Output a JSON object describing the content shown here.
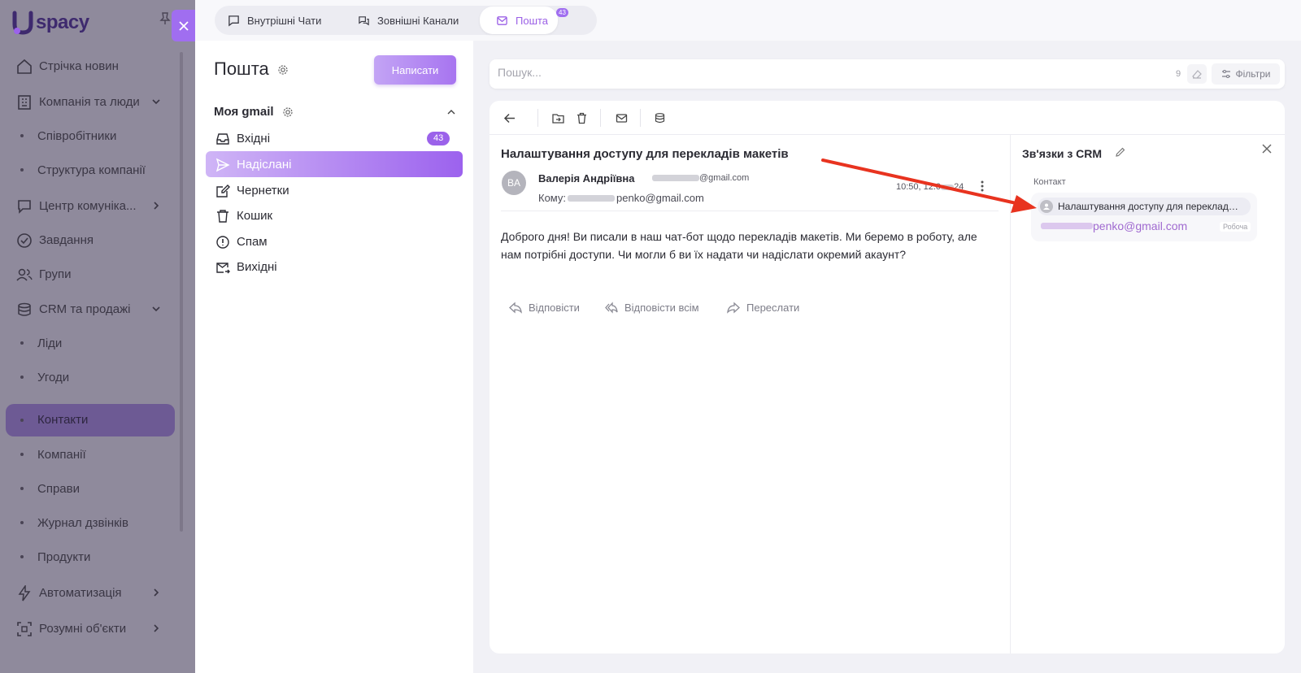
{
  "brand": {
    "logo_text": "spacy",
    "accent": "#a06ef0"
  },
  "sidebar": {
    "items": [
      {
        "label": "Стрічка новин",
        "icon": "home-icon"
      },
      {
        "label": "Компанія та люди",
        "icon": "building-icon"
      },
      {
        "label": "Співробітники"
      },
      {
        "label": "Структура компанії"
      },
      {
        "label": "Центр комуніка...",
        "icon": "chat-icon"
      },
      {
        "label": "Завдання",
        "icon": "check-circle-icon"
      },
      {
        "label": "Групи",
        "icon": "users-icon"
      },
      {
        "label": "CRM та продажі",
        "icon": "coins-icon"
      },
      {
        "label": "Ліди"
      },
      {
        "label": "Угоди"
      },
      {
        "label": "Контакти"
      },
      {
        "label": "Компанії"
      },
      {
        "label": "Справи"
      },
      {
        "label": "Журнал дзвінків"
      },
      {
        "label": "Продукти"
      },
      {
        "label": "Автоматизація",
        "icon": "bolt-icon"
      },
      {
        "label": "Розумні об'єкти",
        "icon": "scan-icon"
      }
    ]
  },
  "tabs": [
    {
      "label": "Внутрішні Чати",
      "icon": "chat-bubble-icon"
    },
    {
      "label": "Зовнішні Канали",
      "icon": "channels-icon"
    },
    {
      "label": "Пошта",
      "icon": "mail-icon",
      "badge": "43"
    }
  ],
  "folders": {
    "title": "Пошта",
    "compose_label": "Написати",
    "account": "Моя gmail",
    "items": [
      {
        "label": "Вхідні",
        "icon": "inbox-icon",
        "count": "43"
      },
      {
        "label": "Надіслані",
        "icon": "send-icon"
      },
      {
        "label": "Чернетки",
        "icon": "edit-icon"
      },
      {
        "label": "Кошик",
        "icon": "trash-icon"
      },
      {
        "label": "Спам",
        "icon": "alert-circle-icon"
      },
      {
        "label": "Вихідні",
        "icon": "outbox-icon"
      }
    ]
  },
  "search": {
    "placeholder": "Пошук...",
    "count": "9",
    "filters_label": "Фільтри"
  },
  "mail": {
    "subject": "Налаштування доступу для перекладів макетів",
    "avatar_initials": "BA",
    "sender_name": "Валерія Андріївна",
    "sender_email_suffix": "@gmail.com",
    "to_label": "Кому:",
    "to_email_suffix": "penko@gmail.com",
    "time": "10:50, 12.0",
    "time_tail": "24",
    "body": "Доброго дня! Ви писали в наш чат-бот щодо перекладів макетів. Ми беремо в роботу, але нам потрібні доступи. Чи могли б ви їх надати чи надіслати окремий акаунт?",
    "reply_label": "Відповісти",
    "reply_all_label": "Відповісти всім",
    "forward_label": "Переслати"
  },
  "crm": {
    "title": "Зв'язки з CRM",
    "section_label": "Контакт",
    "contact_name": "Налаштування доступу для перекладів макетів",
    "contact_email_suffix": "penko@gmail.com",
    "contact_tag": "Робоча"
  }
}
